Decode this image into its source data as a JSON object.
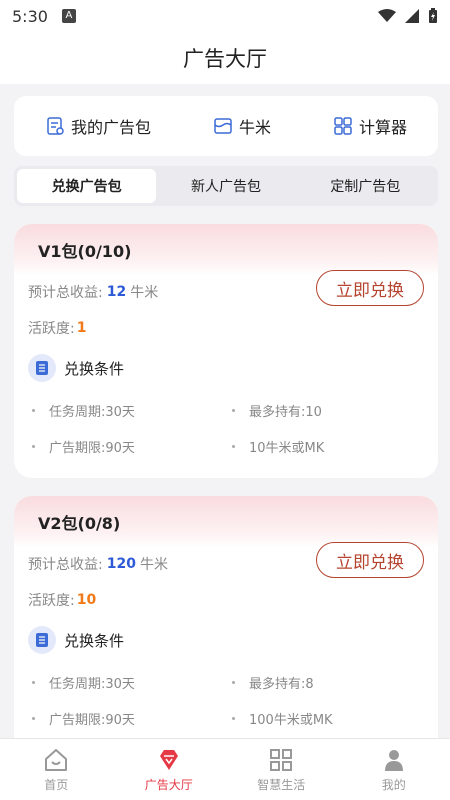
{
  "status": {
    "time": "5:30",
    "notif_letter": "A"
  },
  "header": {
    "title": "广告大厅"
  },
  "menu": [
    {
      "label": "我的广告包",
      "icon": "ad-package-icon"
    },
    {
      "label": "牛米",
      "icon": "wallet-icon"
    },
    {
      "label": "计算器",
      "icon": "grid-apps-icon"
    }
  ],
  "tabs": [
    {
      "label": "兑换广告包",
      "active": true
    },
    {
      "label": "新人广告包",
      "active": false
    },
    {
      "label": "定制广告包",
      "active": false
    }
  ],
  "packages": [
    {
      "name": "V1包(0/10)",
      "income_label": "预计总收益:",
      "income_value": "12",
      "income_unit": "牛米",
      "redeem_label": "立即兑换",
      "activity_label": "活跃度:",
      "activity_value": "1",
      "cond_title": "兑换条件",
      "cond_period": "任务周期:30天",
      "cond_max": "最多持有:10",
      "cond_term": "广告期限:90天",
      "cond_price": "10牛米或MK"
    },
    {
      "name": "V2包(0/8)",
      "income_label": "预计总收益:",
      "income_value": "120",
      "income_unit": "牛米",
      "redeem_label": "立即兑换",
      "activity_label": "活跃度:",
      "activity_value": "10",
      "cond_title": "兑换条件",
      "cond_period": "任务周期:30天",
      "cond_max": "最多持有:8",
      "cond_term": "广告期限:90天",
      "cond_price": "100牛米或MK"
    }
  ],
  "tabbar": [
    {
      "label": "首页",
      "icon": "home-icon",
      "active": false
    },
    {
      "label": "广告大厅",
      "icon": "diamond-icon",
      "active": true
    },
    {
      "label": "智慧生活",
      "icon": "grid-icon",
      "active": false
    },
    {
      "label": "我的",
      "icon": "user-icon",
      "active": false
    }
  ],
  "colors": {
    "accent_red": "#e53946",
    "brand_brown": "#b5442f",
    "income_blue": "#2d5bd8",
    "activity_orange": "#f07a1a"
  }
}
